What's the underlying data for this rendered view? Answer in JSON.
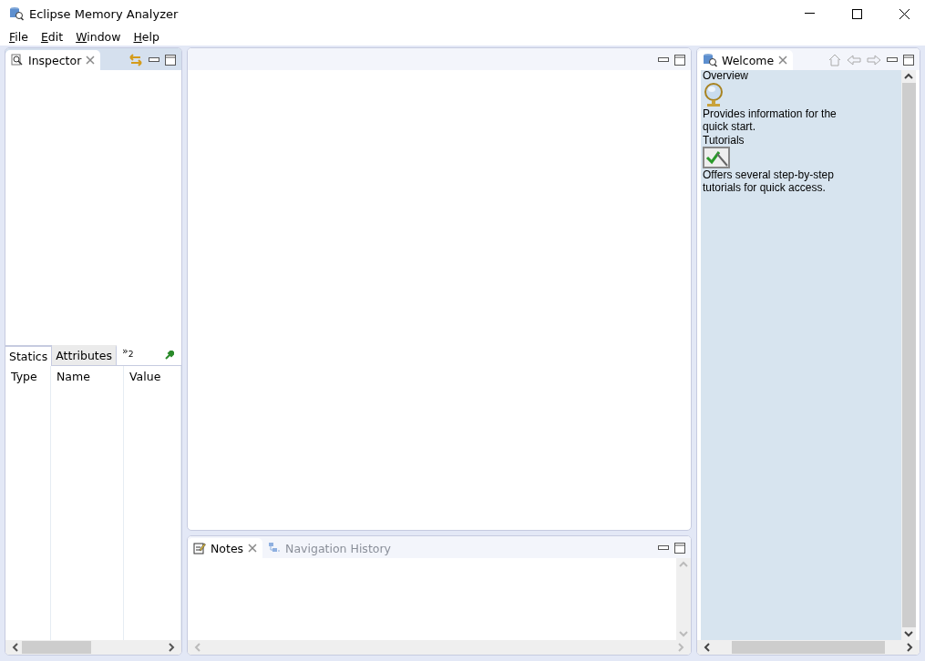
{
  "window": {
    "title": "Eclipse Memory Analyzer"
  },
  "menu": [
    {
      "label": "File"
    },
    {
      "label": "Edit"
    },
    {
      "label": "Window"
    },
    {
      "label": "Help"
    }
  ],
  "inspector": {
    "tabs": [
      {
        "label": "Inspector",
        "selected": true
      }
    ],
    "detail_tabs": [
      {
        "label": "Statics",
        "selected": true
      },
      {
        "label": "Attributes",
        "selected": false
      }
    ],
    "overflow": {
      "glyph": "»",
      "count": "2"
    },
    "columns": [
      "Type",
      "Name",
      "Value"
    ]
  },
  "notes_panel": {
    "tabs": [
      {
        "label": "Notes",
        "selected": true
      },
      {
        "label": "Navigation History",
        "selected": false
      }
    ]
  },
  "welcome": {
    "tabs": [
      {
        "label": "Welcome",
        "selected": true
      }
    ],
    "items": [
      {
        "title": "Overview",
        "description": "Provides information for the quick start."
      },
      {
        "title": "Tutorials",
        "description": "Offers several step-by-step tutorials for quick access."
      }
    ]
  }
}
